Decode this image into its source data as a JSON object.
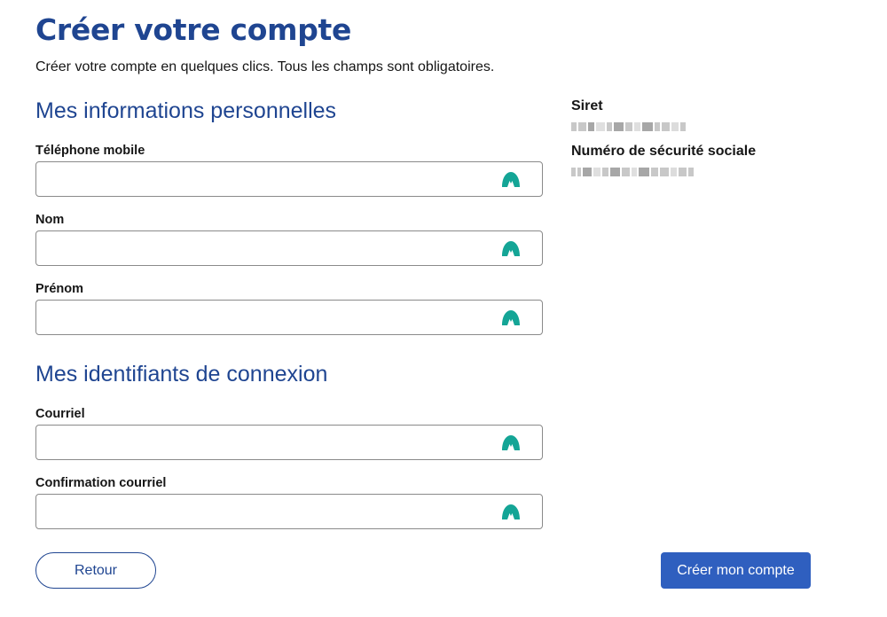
{
  "page": {
    "title": "Créer votre compte",
    "intro": "Créer votre compte en quelques clics. Tous les champs sont obligatoires."
  },
  "personal": {
    "section_title": "Mes informations personnelles",
    "fields": [
      {
        "label": "Téléphone mobile",
        "value": ""
      },
      {
        "label": "Nom",
        "value": ""
      },
      {
        "label": "Prénom",
        "value": ""
      }
    ]
  },
  "credentials": {
    "section_title": "Mes identifiants de connexion",
    "fields": [
      {
        "label": "Courriel",
        "value": ""
      },
      {
        "label": "Confirmation courriel",
        "value": ""
      }
    ]
  },
  "info": {
    "siret_label": "Siret",
    "nss_label": "Numéro de sécurité sociale"
  },
  "actions": {
    "back_label": "Retour",
    "create_label": "Créer mon compte"
  },
  "icons": {
    "field_icon": "password-manager-icon"
  },
  "colors": {
    "title": "#1f4591",
    "primary_button": "#2f5fbf",
    "field_icon": "#14a596"
  }
}
